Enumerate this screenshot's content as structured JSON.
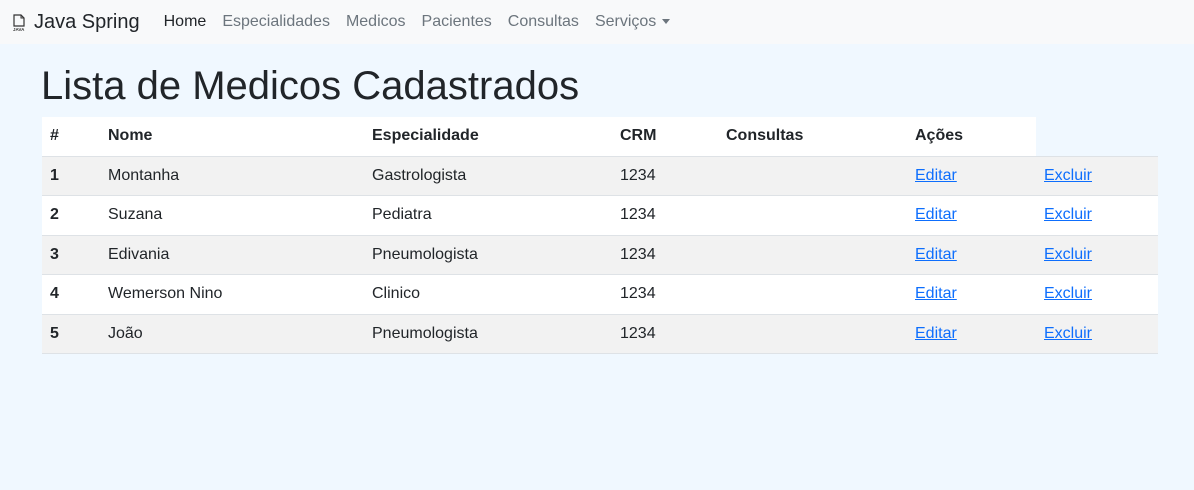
{
  "navbar": {
    "brand": "Java Spring",
    "brand_icon": "java-document-icon",
    "links": [
      {
        "label": "Home",
        "active": true
      },
      {
        "label": "Especialidades"
      },
      {
        "label": "Medicos"
      },
      {
        "label": "Pacientes"
      },
      {
        "label": "Consultas"
      },
      {
        "label": "Serviços",
        "dropdown": true
      }
    ]
  },
  "page": {
    "title": "Lista de Medicos Cadastrados"
  },
  "table": {
    "headers": [
      "#",
      "Nome",
      "Especialidade",
      "CRM",
      "Consultas",
      "Ações"
    ],
    "rows": [
      {
        "id": "1",
        "nome": "Montanha",
        "especialidade": "Gastrologista",
        "crm": "1234",
        "consultas": "",
        "edit": "Editar",
        "delete": "Excluir"
      },
      {
        "id": "2",
        "nome": "Suzana",
        "especialidade": "Pediatra",
        "crm": "1234",
        "consultas": "",
        "edit": "Editar",
        "delete": "Excluir"
      },
      {
        "id": "3",
        "nome": "Edivania",
        "especialidade": "Pneumologista",
        "crm": "1234",
        "consultas": "",
        "edit": "Editar",
        "delete": "Excluir"
      },
      {
        "id": "4",
        "nome": "Wemerson Nino",
        "especialidade": "Clinico",
        "crm": "1234",
        "consultas": "",
        "edit": "Editar",
        "delete": "Excluir"
      },
      {
        "id": "5",
        "nome": "João",
        "especialidade": "Pneumologista",
        "crm": "1234",
        "consultas": "",
        "edit": "Editar",
        "delete": "Excluir"
      }
    ]
  },
  "colors": {
    "background": "#f0f8ff",
    "navbar": "#f8f9fa",
    "link": "#0d6efd",
    "stripe": "#f2f2f2"
  }
}
